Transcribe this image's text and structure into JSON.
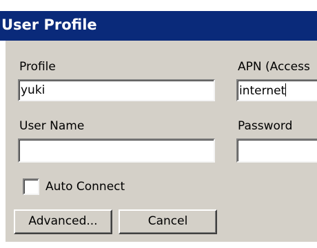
{
  "window": {
    "title": "User Profile",
    "title_bar_color": "#0a2a7a",
    "face_color": "#d4d0c8"
  },
  "form": {
    "profile_label": "Profile",
    "profile_value": "yuki",
    "apn_label": "APN (Access",
    "apn_value": "internet",
    "username_label": "User Name",
    "username_value": "",
    "password_label": "Password",
    "password_value": "",
    "auto_connect_label": "Auto Connect",
    "auto_connect_checked": false
  },
  "buttons": {
    "advanced_label": "Advanced...",
    "cancel_label": "Cancel"
  }
}
